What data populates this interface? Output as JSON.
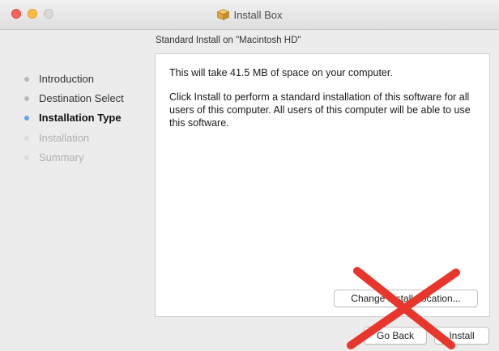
{
  "window": {
    "title": "Install Box",
    "title_icon": "package-icon"
  },
  "sidebar": {
    "steps": [
      {
        "label": "Introduction",
        "state": "done"
      },
      {
        "label": "Destination Select",
        "state": "done"
      },
      {
        "label": "Installation Type",
        "state": "current"
      },
      {
        "label": "Installation",
        "state": "pending"
      },
      {
        "label": "Summary",
        "state": "pending"
      }
    ]
  },
  "main": {
    "subtitle": "Standard Install on \"Macintosh HD\"",
    "paragraph_1": "This will take 41.5 MB of space on your computer.",
    "paragraph_2": "Click Install to perform a standard installation of this software for all users of this computer. All users of this computer will be able to use this software.",
    "change_location_label": "Change Install Location..."
  },
  "footer": {
    "go_back_label": "Go Back",
    "install_label": "Install"
  },
  "colors": {
    "current_step_dot": "#6aa1e8",
    "cross_mark": "#e8362d"
  }
}
